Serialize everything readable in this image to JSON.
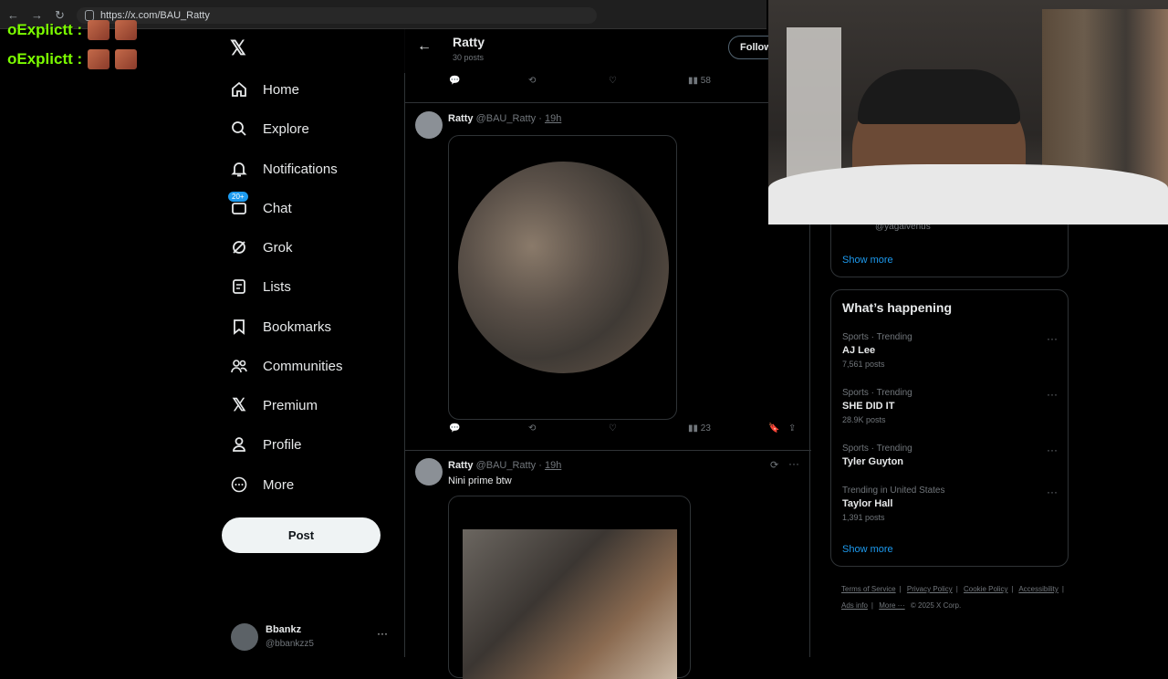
{
  "browser": {
    "url": "https://x.com/BAU_Ratty"
  },
  "chat_overlay": [
    {
      "user": "oExplictt :"
    },
    {
      "user": "oExplictt :"
    }
  ],
  "sidebar": {
    "items": [
      {
        "label": "Home",
        "icon": "home-icon"
      },
      {
        "label": "Explore",
        "icon": "search-icon"
      },
      {
        "label": "Notifications",
        "icon": "bell-icon"
      },
      {
        "label": "Chat",
        "icon": "mail-icon",
        "badge": "20+"
      },
      {
        "label": "Grok",
        "icon": "grok-icon"
      },
      {
        "label": "Lists",
        "icon": "list-icon"
      },
      {
        "label": "Bookmarks",
        "icon": "bookmark-icon"
      },
      {
        "label": "Communities",
        "icon": "people-icon"
      },
      {
        "label": "Premium",
        "icon": "x-icon"
      },
      {
        "label": "Profile",
        "icon": "person-icon"
      },
      {
        "label": "More",
        "icon": "more-circle-icon"
      }
    ],
    "post_label": "Post",
    "account": {
      "name": "Bbankz",
      "handle": "@bbankzz5"
    }
  },
  "profile_header": {
    "name": "Ratty",
    "posts": "30 posts",
    "follow_label": "Follow"
  },
  "tweets": [
    {
      "views": "58"
    },
    {
      "name": "Ratty",
      "handle": "@BAU_Ratty",
      "time": "19h",
      "views": "23"
    },
    {
      "name": "Ratty",
      "handle": "@BAU_Ratty",
      "time": "19h",
      "text": "Nini prime btw"
    }
  ],
  "right": {
    "partial_handle": "@yagalvenus",
    "show_more": "Show more",
    "happening_title": "What’s happening",
    "trends": [
      {
        "category": "Sports · Trending",
        "name": "AJ Lee",
        "count": "7,561 posts"
      },
      {
        "category": "Sports · Trending",
        "name": "SHE DID IT",
        "count": "28.9K posts"
      },
      {
        "category": "Sports · Trending",
        "name": "Tyler Guyton",
        "count": ""
      },
      {
        "category": "Trending in United States",
        "name": "Taylor Hall",
        "count": "1,391 posts"
      }
    ],
    "show_more_2": "Show more",
    "footer": [
      "Terms of Service",
      "Privacy Policy",
      "Cookie Policy",
      "Accessibility",
      "Ads info",
      "More ···",
      "© 2025 X Corp."
    ]
  },
  "colors": {
    "accent": "#1d9bf0",
    "chat_name": "#7cfc00",
    "background": "#000000"
  }
}
